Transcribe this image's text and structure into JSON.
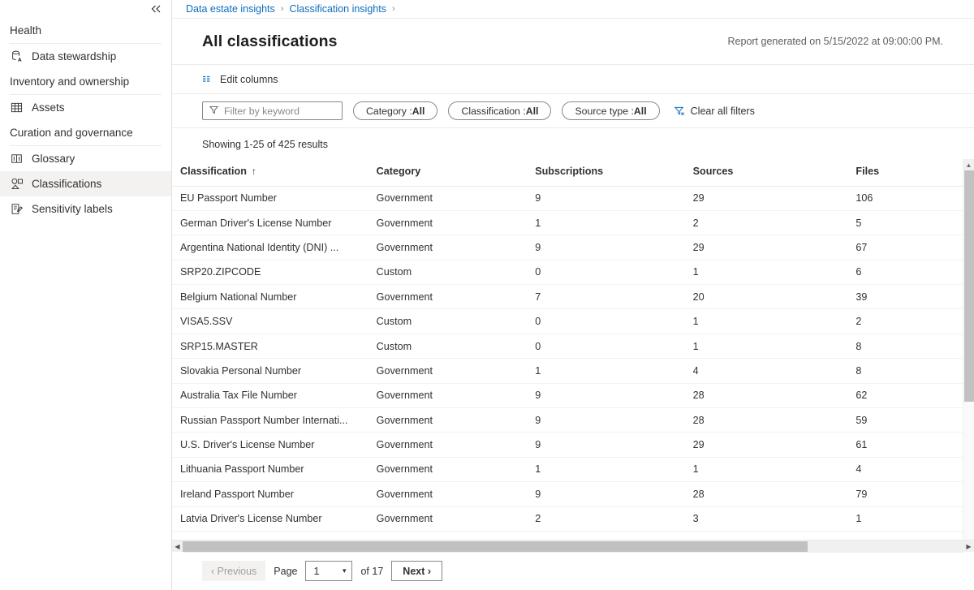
{
  "sidebar": {
    "collapse_icon": "double-chevron-left-icon",
    "groups": [
      {
        "label": "Health",
        "items": [
          {
            "label": "Data stewardship",
            "icon": "data-stewardship-icon",
            "selected": false
          }
        ]
      },
      {
        "label": "Inventory and ownership",
        "items": [
          {
            "label": "Assets",
            "icon": "table-grid-icon",
            "selected": false
          }
        ]
      },
      {
        "label": "Curation and governance",
        "items": [
          {
            "label": "Glossary",
            "icon": "book-icon",
            "selected": false
          },
          {
            "label": "Classifications",
            "icon": "classification-tag-icon",
            "selected": true
          },
          {
            "label": "Sensitivity labels",
            "icon": "sensitivity-label-icon",
            "selected": false
          }
        ]
      }
    ]
  },
  "breadcrumb": {
    "items": [
      "Data estate insights",
      "Classification insights"
    ],
    "separator": "›"
  },
  "header": {
    "title": "All classifications",
    "report_generated": "Report generated on 5/15/2022 at 09:00:00 PM."
  },
  "commandbar": {
    "edit_columns_label": "Edit columns",
    "edit_columns_icon": "edit-columns-icon"
  },
  "filters": {
    "keyword_value": "",
    "keyword_placeholder": "Filter by keyword",
    "keyword_icon": "funnel-icon",
    "pills": [
      {
        "name": "category",
        "label": "Category : ",
        "value": "All"
      },
      {
        "name": "classification",
        "label": "Classification : ",
        "value": "All"
      },
      {
        "name": "source-type",
        "label": "Source type : ",
        "value": "All"
      }
    ],
    "clear_all_label": "Clear all filters",
    "clear_all_icon": "funnel-clear-icon"
  },
  "results": {
    "showing_text": "Showing 1-25 of 425 results"
  },
  "table": {
    "columns": [
      "Classification",
      "Category",
      "Subscriptions",
      "Sources",
      "Files"
    ],
    "sort_column": "Classification",
    "sort_indicator": "↑",
    "rows": [
      {
        "classification": "EU Passport Number",
        "category": "Government",
        "subscriptions": "9",
        "sources": "29",
        "files": "106"
      },
      {
        "classification": "German Driver's License Number",
        "category": "Government",
        "subscriptions": "1",
        "sources": "2",
        "files": "5"
      },
      {
        "classification": "Argentina National Identity (DNI) ...",
        "category": "Government",
        "subscriptions": "9",
        "sources": "29",
        "files": "67"
      },
      {
        "classification": "SRP20.ZIPCODE",
        "category": "Custom",
        "subscriptions": "0",
        "sources": "1",
        "files": "6"
      },
      {
        "classification": "Belgium National Number",
        "category": "Government",
        "subscriptions": "7",
        "sources": "20",
        "files": "39"
      },
      {
        "classification": "VISA5.SSV",
        "category": "Custom",
        "subscriptions": "0",
        "sources": "1",
        "files": "2"
      },
      {
        "classification": "SRP15.MASTER",
        "category": "Custom",
        "subscriptions": "0",
        "sources": "1",
        "files": "8"
      },
      {
        "classification": "Slovakia Personal Number",
        "category": "Government",
        "subscriptions": "1",
        "sources": "4",
        "files": "8"
      },
      {
        "classification": "Australia Tax File Number",
        "category": "Government",
        "subscriptions": "9",
        "sources": "28",
        "files": "62"
      },
      {
        "classification": "Russian Passport Number Internati...",
        "category": "Government",
        "subscriptions": "9",
        "sources": "28",
        "files": "59"
      },
      {
        "classification": "U.S. Driver's License Number",
        "category": "Government",
        "subscriptions": "9",
        "sources": "29",
        "files": "61"
      },
      {
        "classification": "Lithuania Passport Number",
        "category": "Government",
        "subscriptions": "1",
        "sources": "1",
        "files": "4"
      },
      {
        "classification": "Ireland Passport Number",
        "category": "Government",
        "subscriptions": "9",
        "sources": "28",
        "files": "79"
      },
      {
        "classification": "Latvia Driver's License Number",
        "category": "Government",
        "subscriptions": "2",
        "sources": "3",
        "files": "1"
      }
    ]
  },
  "pagination": {
    "previous_label": "‹ Previous",
    "page_label": "Page",
    "page_value": "1",
    "of_label": "of 17",
    "next_label": "Next ›"
  },
  "colors": {
    "link": "#0f6cbd",
    "selected_nav_bg": "#f3f2f1",
    "border": "#edebe9",
    "text": "#323130",
    "muted": "#605e5c"
  }
}
